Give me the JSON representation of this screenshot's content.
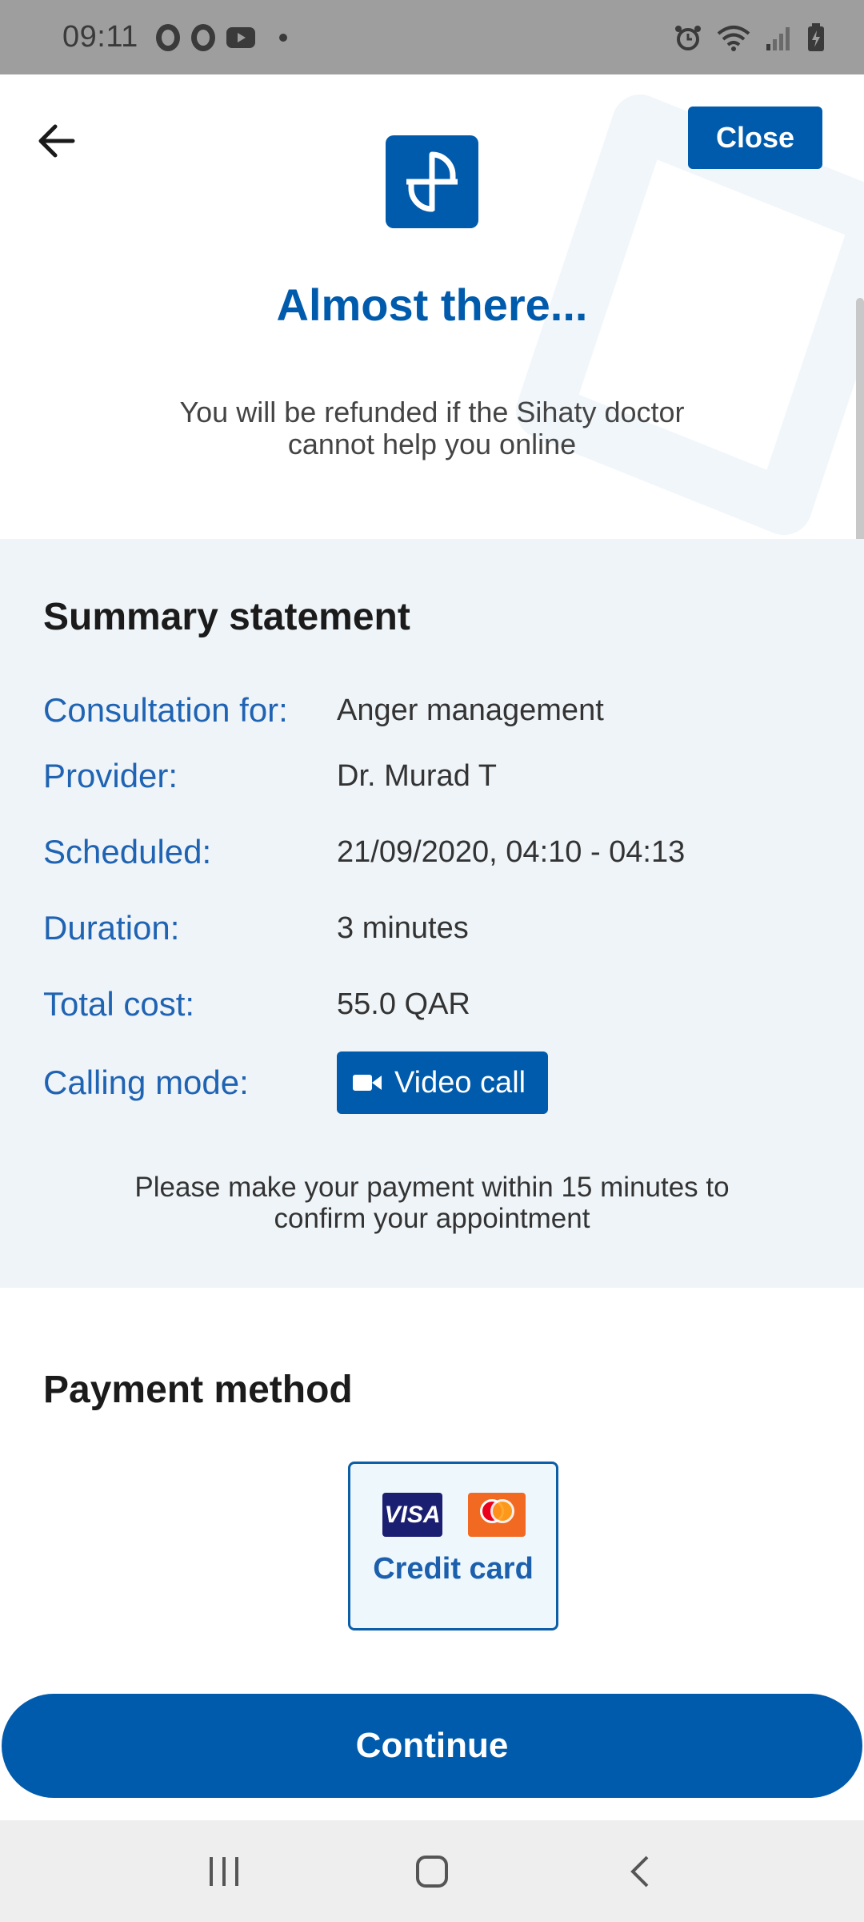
{
  "status_bar": {
    "time": "09:11",
    "icons": [
      "opera-icon",
      "opera-icon",
      "youtube-icon",
      "dot-icon",
      "alarm-icon",
      "wifi-icon",
      "signal-icon",
      "battery-icon"
    ]
  },
  "header": {
    "close_label": "Close",
    "title": "Almost there...",
    "subtitle": "You will be refunded if the Sihaty doctor cannot help you online"
  },
  "summary": {
    "title": "Summary statement",
    "rows": [
      {
        "label": "Consultation for:",
        "value": "Anger management"
      },
      {
        "label": "Provider:",
        "value": "Dr. Murad T"
      },
      {
        "label": "Scheduled:",
        "value": "21/09/2020, 04:10 - 04:13"
      },
      {
        "label": "Duration:",
        "value": "3 minutes"
      },
      {
        "label": "Total cost:",
        "value": "55.0 QAR"
      },
      {
        "label": "Calling mode:",
        "value": "Video call"
      }
    ],
    "note": "Please make your payment within 15 minutes to confirm your appointment"
  },
  "payment": {
    "title": "Payment method",
    "option_label": "Credit card",
    "visa_text": "VISA",
    "mastercard_text": "mastercard"
  },
  "continue_label": "Continue",
  "colors": {
    "brand": "#005bac",
    "label": "#1f63b3",
    "summary_bg": "#eff4f8",
    "card_bg": "#eef7fc"
  }
}
